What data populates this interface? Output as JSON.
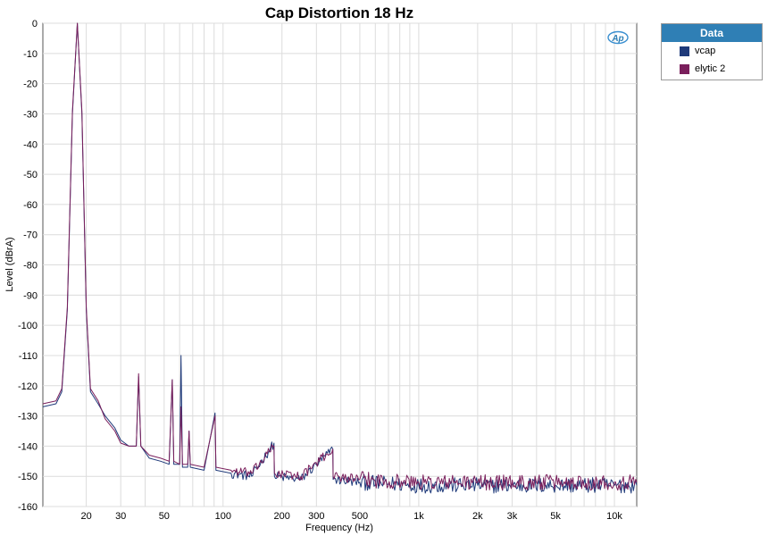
{
  "chart_data": {
    "type": "line",
    "title": "Cap Distortion 18 Hz",
    "xlabel": "Frequency (Hz)",
    "ylabel": "Level (dBrA)",
    "xscale": "log",
    "xlim": [
      12,
      13000
    ],
    "ylim": [
      -160,
      0
    ],
    "grid": true,
    "legend_position": "right-outside",
    "legend_title": "Data",
    "x_ticks": [
      {
        "v": 20,
        "label": "20"
      },
      {
        "v": 30,
        "label": "30"
      },
      {
        "v": 50,
        "label": "50"
      },
      {
        "v": 100,
        "label": "100"
      },
      {
        "v": 200,
        "label": "200"
      },
      {
        "v": 300,
        "label": "300"
      },
      {
        "v": 500,
        "label": "500"
      },
      {
        "v": 1000,
        "label": "1k"
      },
      {
        "v": 2000,
        "label": "2k"
      },
      {
        "v": 3000,
        "label": "3k"
      },
      {
        "v": 5000,
        "label": "5k"
      },
      {
        "v": 10000,
        "label": "10k"
      }
    ],
    "y_ticks": [
      0,
      -10,
      -20,
      -30,
      -40,
      -50,
      -60,
      -70,
      -80,
      -90,
      -100,
      -110,
      -120,
      -130,
      -140,
      -150,
      -160
    ],
    "series": [
      {
        "name": "vcap",
        "color": "#1f3a7a",
        "points": [
          [
            12,
            -127
          ],
          [
            14,
            -126
          ],
          [
            15,
            -122
          ],
          [
            16,
            -95
          ],
          [
            17,
            -30
          ],
          [
            18,
            0
          ],
          [
            19,
            -30
          ],
          [
            20,
            -95
          ],
          [
            21,
            -122
          ],
          [
            23,
            -126
          ],
          [
            25,
            -130
          ],
          [
            28,
            -134
          ],
          [
            30,
            -138
          ],
          [
            33,
            -140
          ],
          [
            36,
            -140
          ],
          [
            37,
            -117
          ],
          [
            38,
            -140
          ],
          [
            42,
            -144
          ],
          [
            48,
            -145
          ],
          [
            53,
            -146
          ],
          [
            55,
            -118
          ],
          [
            56,
            -146
          ],
          [
            60,
            -146
          ],
          [
            61,
            -110
          ],
          [
            62,
            -147
          ],
          [
            66,
            -147
          ],
          [
            67,
            -135
          ],
          [
            68,
            -147
          ],
          [
            80,
            -148
          ],
          [
            91,
            -129
          ],
          [
            92,
            -148
          ],
          [
            110,
            -149
          ],
          [
            140,
            -150
          ],
          [
            182,
            -139
          ],
          [
            183,
            -150
          ],
          [
            250,
            -151
          ],
          [
            364,
            -141
          ],
          [
            365,
            -151
          ],
          [
            500,
            -152
          ],
          [
            1000,
            -153
          ],
          [
            2000,
            -153
          ],
          [
            5000,
            -153
          ],
          [
            10000,
            -153
          ],
          [
            13000,
            -153
          ]
        ]
      },
      {
        "name": "elytic 2",
        "color": "#7a1f5c",
        "points": [
          [
            12,
            -126
          ],
          [
            14,
            -125
          ],
          [
            15,
            -121
          ],
          [
            16,
            -94
          ],
          [
            17,
            -29
          ],
          [
            18,
            0
          ],
          [
            19,
            -29
          ],
          [
            20,
            -94
          ],
          [
            21,
            -121
          ],
          [
            23,
            -125
          ],
          [
            25,
            -131
          ],
          [
            28,
            -135
          ],
          [
            30,
            -139
          ],
          [
            33,
            -140
          ],
          [
            36,
            -140
          ],
          [
            37,
            -116
          ],
          [
            38,
            -140
          ],
          [
            42,
            -143
          ],
          [
            48,
            -144
          ],
          [
            53,
            -145
          ],
          [
            55,
            -118
          ],
          [
            56,
            -145
          ],
          [
            60,
            -146
          ],
          [
            61,
            -127
          ],
          [
            62,
            -146
          ],
          [
            66,
            -146
          ],
          [
            67,
            -135
          ],
          [
            68,
            -146
          ],
          [
            80,
            -147
          ],
          [
            91,
            -130
          ],
          [
            92,
            -147
          ],
          [
            110,
            -148
          ],
          [
            140,
            -149
          ],
          [
            182,
            -140
          ],
          [
            183,
            -149
          ],
          [
            250,
            -150
          ],
          [
            364,
            -141
          ],
          [
            365,
            -150
          ],
          [
            500,
            -151
          ],
          [
            1000,
            -152
          ],
          [
            2000,
            -152
          ],
          [
            5000,
            -152
          ],
          [
            10000,
            -152
          ],
          [
            13000,
            -152
          ]
        ]
      }
    ]
  }
}
